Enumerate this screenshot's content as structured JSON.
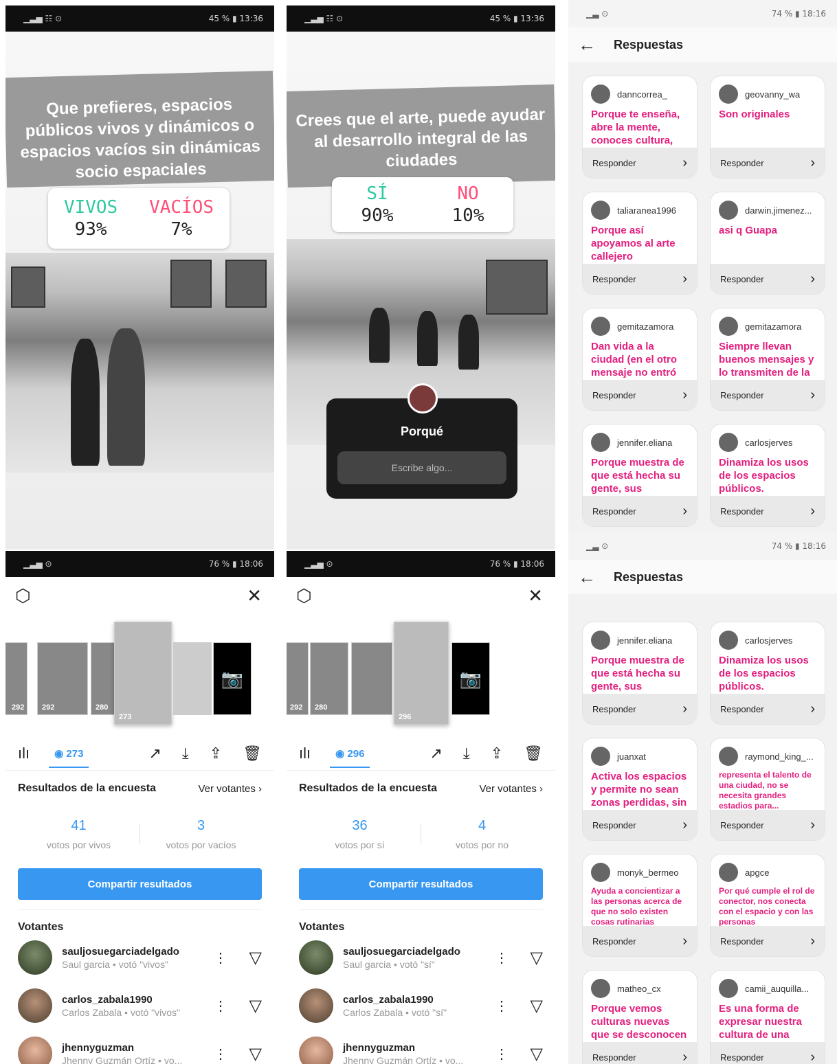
{
  "story1": {
    "status": {
      "left": "▁▃▅ ☷ ⊙",
      "right": "45 % ▮ 13:36"
    },
    "question": "Que prefieres, espacios públicos vivos y dinámicos o espacios vacíos sin dinámicas socio espaciales",
    "opt_a": "VIVOS",
    "pct_a": "93%",
    "opt_b": "VACÍOS",
    "pct_b": "7%",
    "colors": {
      "a": "#2fc9a0",
      "b": "#ff4f79"
    }
  },
  "story2": {
    "status": {
      "left": "▁▃▅ ☷ ⊙",
      "right": "45 % ▮ 13:36"
    },
    "question": "Crees que el arte, puede ayudar al desarrollo integral de las ciudades",
    "opt_a": "SÍ",
    "pct_a": "90%",
    "opt_b": "NO",
    "pct_b": "10%",
    "box_title": "Porqué",
    "box_placeholder": "Escribe algo..."
  },
  "insights1": {
    "status": {
      "left": "▁▃▅ ⊙",
      "right": "76 % ▮ 18:06"
    },
    "thumb_counts": [
      "292",
      "280",
      "273"
    ],
    "views": "273",
    "results_title": "Resultados de la encuesta",
    "see_voters": "Ver votantes",
    "a_count": "41",
    "a_label": "votos por vivos",
    "b_count": "3",
    "b_label": "votos por vacíos",
    "share": "Compartir resultados",
    "voters_title": "Votantes",
    "voters": [
      {
        "user": "sauljosuegarciadelgado",
        "sub": "Saul garcia • votó \"vivos\""
      },
      {
        "user": "carlos_zabala1990",
        "sub": "Carlos Zabala • votó \"vivos\""
      },
      {
        "user": "jhennyguzman",
        "sub": "Jhenny Guzmán Ortíz • vo..."
      }
    ]
  },
  "insights2": {
    "status": {
      "left": "▁▃▅ ⊙",
      "right": "76 % ▮ 18:06"
    },
    "thumb_counts": [
      "292",
      "280",
      "296"
    ],
    "views": "296",
    "results_title": "Resultados de la encuesta",
    "see_voters": "Ver votantes",
    "a_count": "36",
    "a_label": "votos por sí",
    "b_count": "4",
    "b_label": "votos por no",
    "share": "Compartir resultados",
    "voters_title": "Votantes",
    "voters": [
      {
        "user": "sauljosuegarciadelgado",
        "sub": "Saul garcia • votó \"sí\""
      },
      {
        "user": "carlos_zabala1990",
        "sub": "Carlos Zabala • votó \"sí\""
      },
      {
        "user": "jhennyguzman",
        "sub": "Jhenny Guzmán Ortíz • vo..."
      }
    ]
  },
  "responses1": {
    "status": {
      "left": "▁▃ ⊙",
      "right": "74 % ▮ 18:16"
    },
    "title": "Respuestas",
    "reply": "Responder",
    "cards": [
      {
        "user": "danncorrea_",
        "text": "Porque te enseña, abre la mente, conoces cultura,"
      },
      {
        "user": "geovanny_wa",
        "text": "Son originales"
      },
      {
        "user": "taliaranea1996",
        "text": "Porque así apoyamos al arte callejero"
      },
      {
        "user": "darwin.jimenez...",
        "text": "asi q Guapa"
      },
      {
        "user": "gemitazamora",
        "text": "Dan vida a la ciudad (en el otro mensaje no entró"
      },
      {
        "user": "gemitazamora",
        "text": "Siempre llevan buenos mensajes y lo transmiten de la"
      },
      {
        "user": "jennifer.eliana",
        "text": "Porque muestra de que está hecha su gente, sus ancianos,"
      },
      {
        "user": "carlosjerves",
        "text": "Dinamiza los usos de los espacios públicos."
      }
    ]
  },
  "responses2": {
    "status": {
      "left": "▁▃ ⊙",
      "right": "74 % ▮ 18:16"
    },
    "title": "Respuestas",
    "reply": "Responder",
    "cards": [
      {
        "user": "jennifer.eliana",
        "text": "Porque muestra de que está hecha su gente, sus ancianos,"
      },
      {
        "user": "carlosjerves",
        "text": "Dinamiza los usos de los espacios públicos."
      },
      {
        "user": "juanxat",
        "text": "Activa los espacios y permite no sean zonas perdidas, sin"
      },
      {
        "user": "raymond_king_...",
        "text": "representa el talento de una ciudad, no se necesita grandes estadios para..."
      },
      {
        "user": "monyk_bermeo",
        "text": "Ayuda a concientizar a las personas acerca de que no solo  existen cosas rutinarias"
      },
      {
        "user": "apgce",
        "text": "Por qué cumple el rol de conector, nos conecta con el espacio y con las personas"
      },
      {
        "user": "matheo_cx",
        "text": "Porque vemos culturas nuevas que se desconocen"
      },
      {
        "user": "camii_auquilla...",
        "text": "Es una forma de expresar nuestra cultura de una"
      }
    ]
  }
}
